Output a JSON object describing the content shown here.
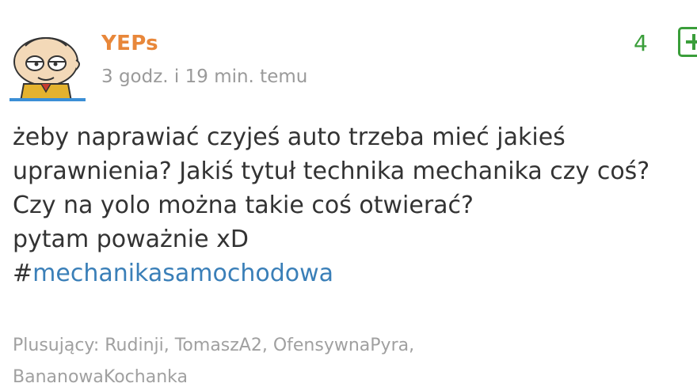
{
  "post": {
    "author": "YEPs",
    "time": "3 godz. i 19 min. temu",
    "votes": "4",
    "plus_symbol": "+",
    "lines": [
      "żeby naprawiać czyjeś auto trzeba mieć jakieś",
      "uprawnienia? Jakiś tytuł technika mechanika czy coś?",
      "Czy na yolo można takie coś otwierać?",
      "pytam poważnie xD"
    ],
    "tag_hash": "#",
    "tag_name": "mechanikasamochodowa",
    "plusers_label": "Plusujący:",
    "plusers_list": "Rudinji, TomaszA2, OfensywnaPyra,",
    "plusers_line2": "BananowaKochanka"
  },
  "colors": {
    "author": "#e8873a",
    "votes": "#3a9e3a",
    "tag": "#3a7fb8",
    "avatar_bar": "#3b8fd6"
  },
  "icons": {
    "avatar": "cartoon-character-avatar",
    "plus": "plus-icon"
  }
}
